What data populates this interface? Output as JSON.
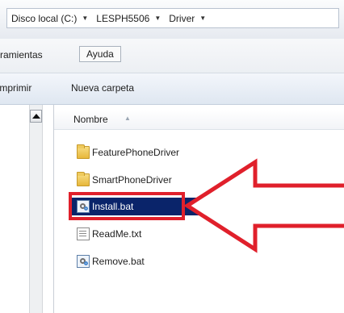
{
  "address": {
    "crumbs": [
      {
        "label": "Disco local (C:)"
      },
      {
        "label": "LESPH5506"
      },
      {
        "label": "Driver"
      }
    ]
  },
  "menu": {
    "herramientas": "rramientas",
    "ayuda": "Ayuda"
  },
  "toolbar": {
    "imprimir": "Imprimir",
    "nueva_carpeta": "Nueva carpeta"
  },
  "columns": {
    "nombre": "Nombre"
  },
  "files": [
    {
      "name": "FeaturePhoneDriver",
      "icon": "folder-icon"
    },
    {
      "name": "SmartPhoneDriver",
      "icon": "folder-icon"
    },
    {
      "name": "Install.bat",
      "icon": "batch-file-icon",
      "selected": true
    },
    {
      "name": "ReadMe.txt",
      "icon": "text-file-icon"
    },
    {
      "name": "Remove.bat",
      "icon": "batch-file-icon"
    }
  ],
  "annotation": {
    "box_color": "#e0202b",
    "arrow_color": "#e0202b",
    "selection_color": "#0a246a"
  }
}
